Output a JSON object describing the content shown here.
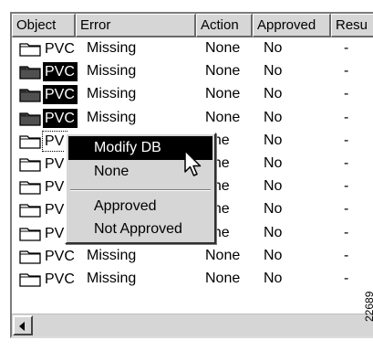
{
  "columns": [
    {
      "label": "Object"
    },
    {
      "label": "Error"
    },
    {
      "label": "Action"
    },
    {
      "label": "Approved"
    },
    {
      "label": "Resu"
    }
  ],
  "rows": [
    {
      "object": "PVC",
      "error": "Missing",
      "action": "None",
      "approved": "No",
      "result": "-",
      "selected": false
    },
    {
      "object": "PVC",
      "error": "Missing",
      "action": "None",
      "approved": "No",
      "result": "-",
      "selected": true
    },
    {
      "object": "PVC",
      "error": "Missing",
      "action": "None",
      "approved": "No",
      "result": "-",
      "selected": true
    },
    {
      "object": "PVC",
      "error": "Missing",
      "action": "None",
      "approved": "No",
      "result": "-",
      "selected": true
    },
    {
      "object": "PV",
      "error": "",
      "action": "one",
      "approved": "No",
      "result": "-",
      "selected": false,
      "focus": true
    },
    {
      "object": "PV",
      "error": "",
      "action": "one",
      "approved": "No",
      "result": "-",
      "selected": false
    },
    {
      "object": "PV",
      "error": "",
      "action": "one",
      "approved": "No",
      "result": "-",
      "selected": false
    },
    {
      "object": "PV",
      "error": "",
      "action": "one",
      "approved": "No",
      "result": "-",
      "selected": false
    },
    {
      "object": "PV",
      "error": "",
      "action": "one",
      "approved": "No",
      "result": "-",
      "selected": false
    },
    {
      "object": "PVC",
      "error": "Missing",
      "action": "None",
      "approved": "No",
      "result": "-",
      "selected": false
    },
    {
      "object": "PVC",
      "error": "Missing",
      "action": "None",
      "approved": "No",
      "result": "-",
      "selected": false
    }
  ],
  "context_menu": {
    "items": [
      {
        "label": "Modify DB",
        "highlighted": true
      },
      {
        "label": "None",
        "highlighted": false
      },
      {
        "label": "Approved",
        "highlighted": false
      },
      {
        "label": "Not Approved",
        "highlighted": false
      }
    ]
  },
  "figure_id": "22689",
  "icons": {
    "object_icon": "folder-icon",
    "cursor": "mouse-pointer-icon",
    "scroll_left": "scroll-left-arrow-icon"
  },
  "colors": {
    "selection": "#000000",
    "chrome": "#d6d6d6"
  }
}
